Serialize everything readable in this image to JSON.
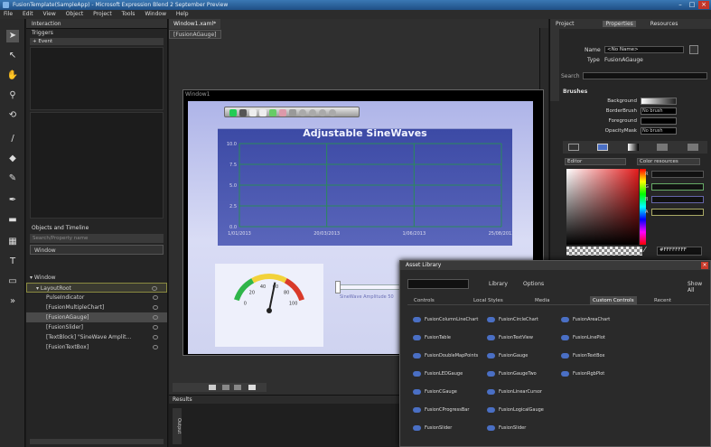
{
  "window": {
    "title": "FusionTemplate(SampleApp) - Microsoft Expression Blend 2 September Preview"
  },
  "menu": [
    "File",
    "Edit",
    "View",
    "Object",
    "Project",
    "Tools",
    "Window",
    "Help"
  ],
  "interaction": {
    "header": "Interaction",
    "triggers_header": "Triggers",
    "trigger_item": "+ Event",
    "objects_header": "Objects and Timeline",
    "search_placeholder": "Search/Property name",
    "tree": [
      {
        "label": "Window"
      },
      {
        "label": "Window"
      },
      {
        "label": "LayoutRoot"
      },
      {
        "label": "PulseIndicator"
      },
      {
        "label": "[FusionMultipleChart]"
      },
      {
        "label": "[FusionAGauge]"
      },
      {
        "label": "[FusionSlider]"
      },
      {
        "label": "[TextBlock] \"SineWave Amplit..."
      },
      {
        "label": "[FusionTextBox]"
      }
    ]
  },
  "document": {
    "tab": "Window1.xaml*",
    "breadcrumb": "[FusionAGauge]",
    "window_label": "Window1",
    "results_label": "Results",
    "results_tab": "Output"
  },
  "chart": {
    "title": "Adjustable SineWaves",
    "slider_value": "SineWave Amplitude 50"
  },
  "chart_data": {
    "type": "line",
    "title": "Adjustable SineWaves",
    "y_ticks": [
      "10.0",
      "7.5",
      "5.0",
      "2.5",
      "0.0"
    ],
    "x_ticks": [
      "1/01/2013",
      "20/03/2013",
      "1/06/2013",
      "25/08/2013"
    ],
    "ylim": [
      0,
      10
    ],
    "grid": true,
    "series": []
  },
  "gauge": {
    "ticks": [
      "0",
      "20",
      "40",
      "60",
      "80",
      "100"
    ],
    "value_fraction": 0.58
  },
  "properties": {
    "tabs": [
      "Project",
      "Properties",
      "Resources"
    ],
    "name_label": "Name",
    "name_value": "<No Name>",
    "type_label": "Type",
    "type_value": "FusionAGauge",
    "search_label": "Search",
    "brushes_header": "Brushes",
    "brushes": [
      {
        "key": "Background",
        "value": ""
      },
      {
        "key": "BorderBrush",
        "value": "No brush"
      },
      {
        "key": "Foreground",
        "value": ""
      },
      {
        "key": "OpacityMask",
        "value": "No brush"
      }
    ],
    "editor_tabs": [
      "Editor",
      "Color resources"
    ],
    "channels": [
      "R",
      "G",
      "B",
      "A"
    ],
    "hex_value": "#FFFFFFFF"
  },
  "asset_library": {
    "title": "Asset Library",
    "library_label": "Library",
    "options_label": "Options",
    "show_all": "Show All",
    "tabs": [
      "Controls",
      "Local Styles",
      "Media",
      "Custom Controls",
      "Recent"
    ],
    "active_tab": "Custom Controls",
    "items": [
      "FusionColumnLineChart",
      "FusionCircleChart",
      "FusionAreaChart",
      "FusionTable",
      "FusionTextView",
      "FusionLinePlot",
      "FusionDoubleMapPoints",
      "FusionGauge",
      "FusionTextBox",
      "FusionLEDGauge",
      "FusionGaugeTwo",
      "FusionRgbPlot",
      "FusionCGauge",
      "FusionLinearCursor",
      "",
      "FusionCProgressBar",
      "FusionLogicalGauge",
      "",
      "FusionSlider",
      "FusionSlider",
      ""
    ]
  },
  "colors": {
    "accent": "#3c4aa5",
    "titlebar": "#2f66a6",
    "dark_bg": "#252525"
  }
}
